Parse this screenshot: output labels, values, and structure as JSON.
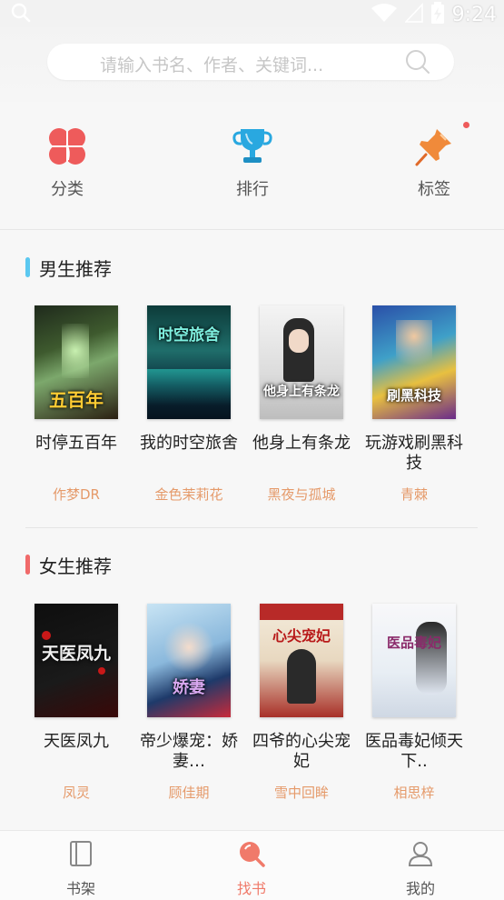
{
  "status_bar": {
    "time": "9:24"
  },
  "search": {
    "placeholder": "请输入书名、作者、关键词..."
  },
  "quick_nav": [
    {
      "label": "分类",
      "icon": "clover-icon"
    },
    {
      "label": "排行",
      "icon": "trophy-icon"
    },
    {
      "label": "标签",
      "icon": "pin-icon"
    }
  ],
  "sections": {
    "male": {
      "title": "男生推荐",
      "accent": "#5bc8f0",
      "books": [
        {
          "title": "时停五百年",
          "author": "作梦DR",
          "cover_text": "五百年"
        },
        {
          "title": "我的时空旅舍",
          "author": "金色茉莉花",
          "cover_text": "时空旅舍"
        },
        {
          "title": "他身上有条龙",
          "author": "黑夜与孤城",
          "cover_text": "他身上有条龙"
        },
        {
          "title": "玩游戏刷黑科技",
          "author": "青棘",
          "cover_text": "刷黑科技"
        }
      ]
    },
    "female": {
      "title": "女生推荐",
      "accent": "#f06a6a",
      "books": [
        {
          "title": "天医凤九",
          "author": "凤灵",
          "cover_text": "天医凤九"
        },
        {
          "title": "帝少爆宠：娇妻…",
          "author": "顾佳期",
          "cover_text": "娇妻"
        },
        {
          "title": "四爷的心尖宠妃",
          "author": "雪中回眸",
          "cover_text": "心尖宠妃"
        },
        {
          "title": "医品毒妃倾天下..",
          "author": "相思梓",
          "cover_text": "医品毒妃"
        }
      ]
    }
  },
  "tabs": [
    {
      "label": "书架",
      "icon": "bookshelf-icon",
      "active": false
    },
    {
      "label": "找书",
      "icon": "find-book-icon",
      "active": true
    },
    {
      "label": "我的",
      "icon": "profile-icon",
      "active": false
    }
  ],
  "colors": {
    "author": "#e59a6a",
    "active_tab": "#f07a6a",
    "clover": "#ee5b5b",
    "trophy": "#29a8e0",
    "pin": "#f08a3a"
  }
}
